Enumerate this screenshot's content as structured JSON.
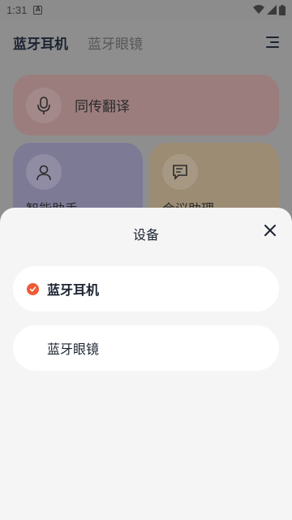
{
  "status_bar": {
    "time": "1:31",
    "notif_glyph": "A"
  },
  "header": {
    "tabs": [
      {
        "label": "蓝牙耳机"
      },
      {
        "label": "蓝牙眼镜"
      }
    ]
  },
  "cards": {
    "translate": "同传翻译",
    "assistant": "智能助手",
    "meeting": "会议助理"
  },
  "sheet": {
    "title": "设备",
    "devices": [
      {
        "label": "蓝牙耳机",
        "selected": true
      },
      {
        "label": "蓝牙眼镜",
        "selected": false
      }
    ]
  },
  "colors": {
    "accent": "#ef5a36",
    "text": "#1c2432"
  }
}
